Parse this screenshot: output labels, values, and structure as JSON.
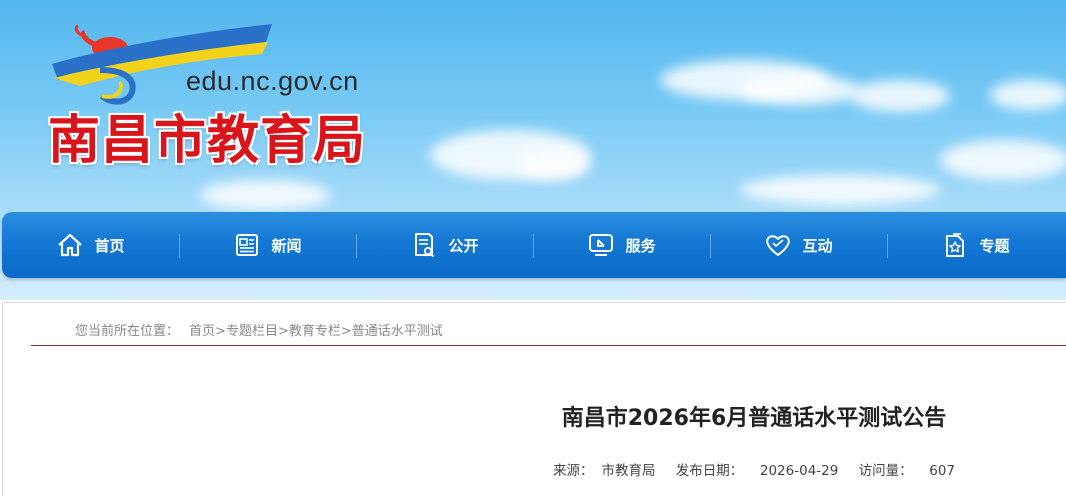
{
  "header": {
    "domain": "edu.nc.gov.cn",
    "site_title": "南昌市教育局"
  },
  "nav": {
    "items": [
      {
        "label": "首页",
        "icon": "home-icon"
      },
      {
        "label": "新闻",
        "icon": "newspaper-icon"
      },
      {
        "label": "公开",
        "icon": "document-search-icon"
      },
      {
        "label": "服务",
        "icon": "service-monitor-icon"
      },
      {
        "label": "互动",
        "icon": "heart-icon"
      },
      {
        "label": "专题",
        "icon": "star-document-icon"
      }
    ]
  },
  "breadcrumb": {
    "prefix": "您当前所在位置：",
    "items": [
      "首页",
      "专题栏目",
      "教育专栏",
      "普通话水平测试"
    ],
    "separator": ">"
  },
  "article": {
    "title": "南昌市2026年6月普通话水平测试公告",
    "source_label": "来源：",
    "source": "市教育局",
    "date_label": "发布日期：",
    "date": "2026-04-29",
    "views_label": "访问量：",
    "views": "607"
  },
  "colors": {
    "nav_bg": "#1478d4",
    "title_red": "#d9141b",
    "divider": "#8a2a2a"
  }
}
